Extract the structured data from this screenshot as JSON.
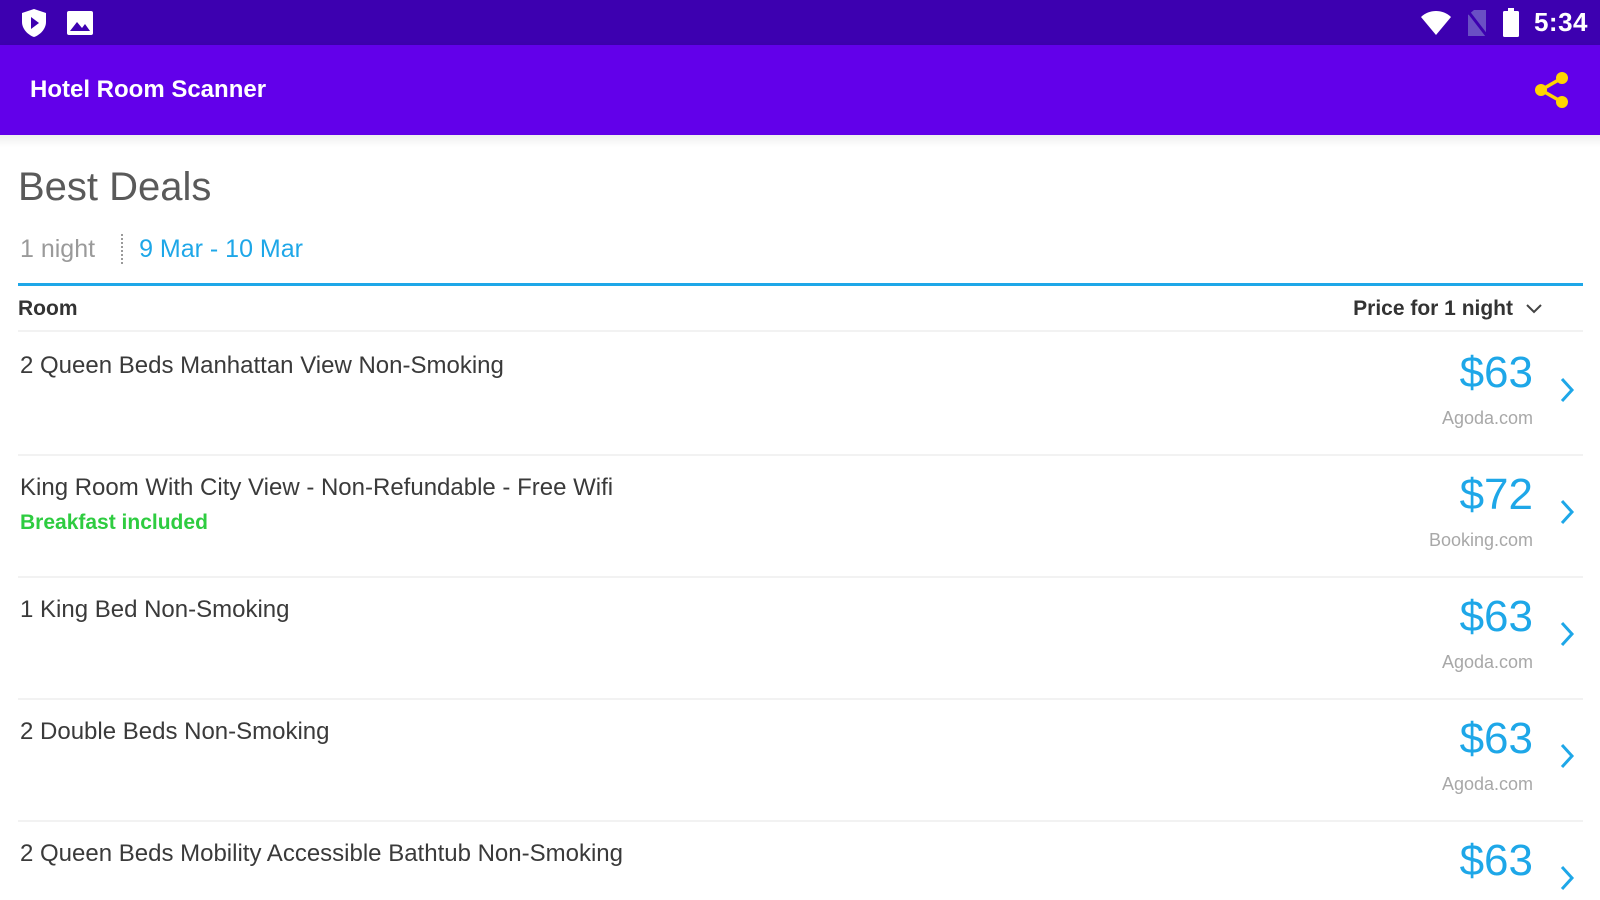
{
  "status_bar": {
    "time": "5:34",
    "icons": [
      "shield-play-icon",
      "image-icon",
      "wifi-icon",
      "no-sim-icon",
      "battery-icon"
    ]
  },
  "app_bar": {
    "title": "Hotel Room Scanner",
    "share_icon": "share-icon"
  },
  "deals": {
    "title": "Best Deals",
    "nights": "1 night",
    "date_range": "9 Mar - 10 Mar"
  },
  "table": {
    "col_room": "Room",
    "col_price": "Price for 1 night"
  },
  "rooms": [
    {
      "name": "2 Queen Beds Manhattan View Non-Smoking",
      "extra": "",
      "price": "$63",
      "source": "Agoda.com"
    },
    {
      "name": "King Room With City View - Non-Refundable - Free Wifi",
      "extra": "Breakfast included",
      "price": "$72",
      "source": "Booking.com"
    },
    {
      "name": "1 King Bed Non-Smoking",
      "extra": "",
      "price": "$63",
      "source": "Agoda.com"
    },
    {
      "name": "2 Double Beds Non-Smoking",
      "extra": "",
      "price": "$63",
      "source": "Agoda.com"
    },
    {
      "name": "2 Queen Beds Mobility Accessible Bathtub Non-Smoking",
      "extra": "",
      "price": "$63",
      "source": ""
    }
  ],
  "colors": {
    "status_bar": "#3d00b0",
    "app_bar": "#6200ea",
    "accent_blue": "#1ea7e8",
    "share_icon": "#ffd600",
    "breakfast_green": "#2ecc40"
  }
}
